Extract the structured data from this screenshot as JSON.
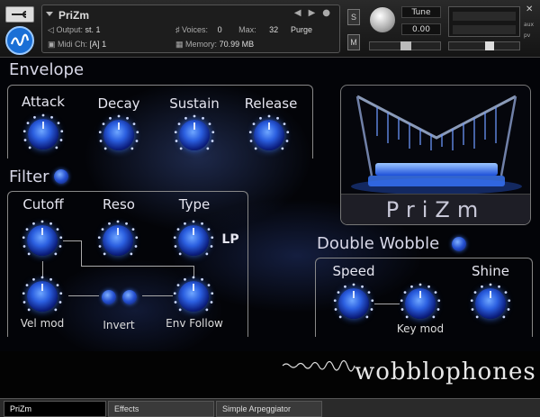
{
  "header": {
    "instrument_name": "PriZm",
    "output_label": "Output:",
    "output_value": "st. 1",
    "voices_label": "Voices:",
    "voices_value": "0",
    "max_label": "Max:",
    "max_value": "32",
    "purge_label": "Purge",
    "midi_label": "Midi Ch:",
    "midi_value": "[A] 1",
    "memory_label": "Memory:",
    "memory_value": "70.99 MB",
    "solo_label": "S",
    "mute_label": "M",
    "tune_label": "Tune",
    "tune_value": "0.00",
    "pan_label": "L░R",
    "aux_label": "aux",
    "pv_label": "pv"
  },
  "envelope": {
    "title": "Envelope",
    "knobs": [
      {
        "label": "Attack"
      },
      {
        "label": "Decay"
      },
      {
        "label": "Sustain"
      },
      {
        "label": "Release"
      }
    ]
  },
  "filter": {
    "title": "Filter",
    "cutoff_label": "Cutoff",
    "reso_label": "Reso",
    "type_label": "Type",
    "type_value": "LP",
    "velmod_label": "Vel mod",
    "invert_label": "Invert",
    "envfollow_label": "Env Follow"
  },
  "wobble": {
    "title": "Double Wobble",
    "speed_label": "Speed",
    "shine_label": "Shine",
    "keymod_label": "Key mod"
  },
  "artwork": {
    "title": "PriZm"
  },
  "brand": "wobblophones",
  "tabs": [
    {
      "label": "PriZm",
      "active": true
    },
    {
      "label": "Effects",
      "active": false
    },
    {
      "label": "Simple Arpeggiator",
      "active": false
    }
  ],
  "colors": {
    "knob_blue": "#2b5fe0",
    "glow": "#3c78ff"
  }
}
